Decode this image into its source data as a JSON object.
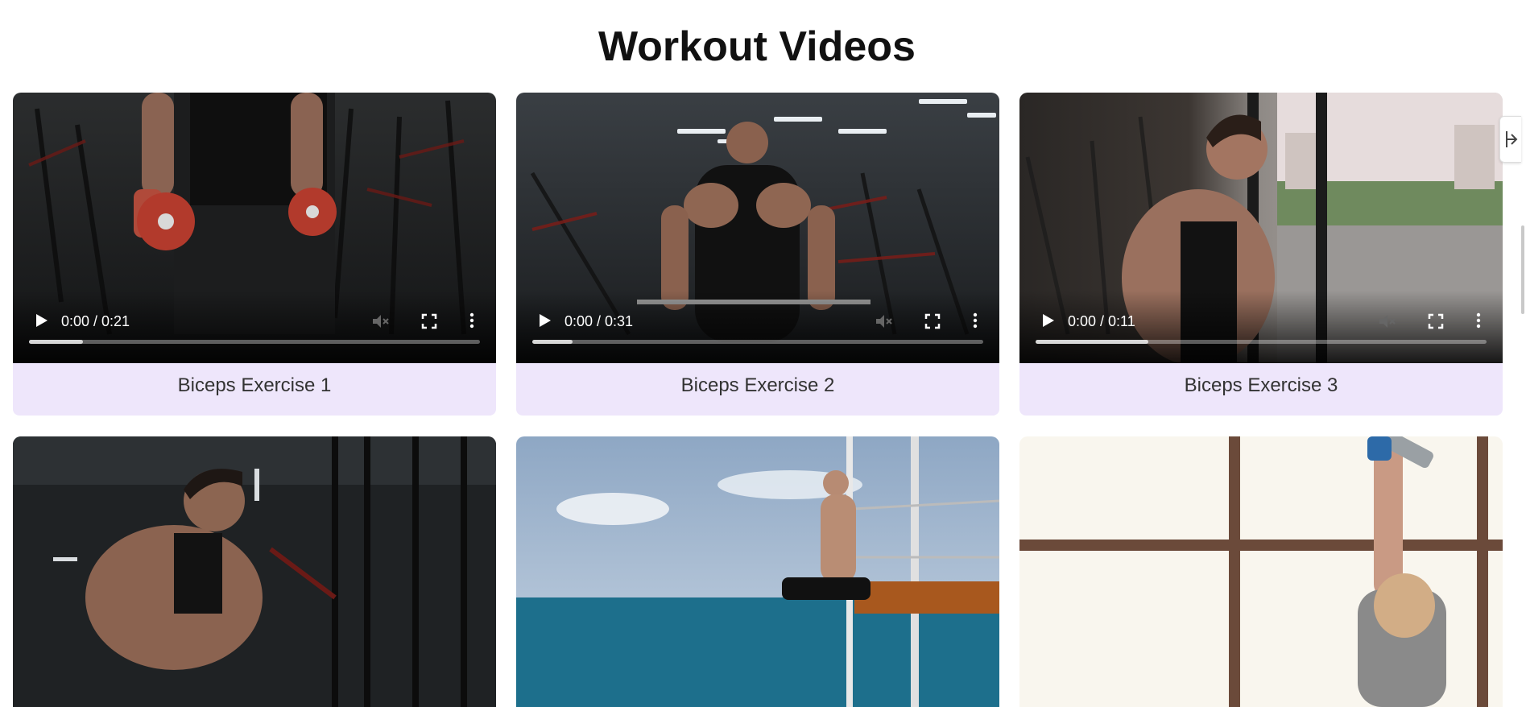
{
  "page": {
    "title": "Workout Videos"
  },
  "videos": [
    {
      "caption": "Biceps Exercise 1",
      "time": "0:00 / 0:21",
      "buffered": 0.12
    },
    {
      "caption": "Biceps Exercise 2",
      "time": "0:00 / 0:31",
      "buffered": 0.09
    },
    {
      "caption": "Biceps Exercise 3",
      "time": "0:00 / 0:11",
      "buffered": 0.25
    },
    {
      "caption": "",
      "time": "",
      "buffered": 0
    },
    {
      "caption": "",
      "time": "",
      "buffered": 0
    },
    {
      "caption": "",
      "time": "",
      "buffered": 0
    }
  ],
  "icons": {
    "play": "play-icon",
    "mute": "volume-muted-icon",
    "fullscreen": "fullscreen-icon",
    "more": "more-vertical-icon",
    "side_tab": "collapse-panel-icon"
  },
  "colors": {
    "caption_bg": "#eee6fb",
    "title": "#111111"
  }
}
